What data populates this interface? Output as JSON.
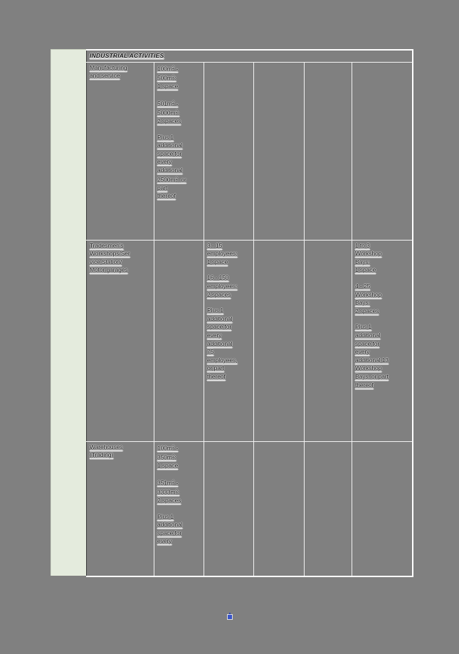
{
  "document": {
    "section_header": "INDUSTRIAL ACTIVITIES",
    "page_background": "#808080",
    "margin_strip_color": "#e4ebdd",
    "table_border_color": "#f2f2f2",
    "text_color": "#1b1b1b"
  },
  "table": {
    "columns": 6,
    "rows": [
      {
        "name": "manufacturing-and-service",
        "cells": {
          "activity": "Manufacturing\nand service",
          "floor_area": {
            "band1": "100m² -\n500m²:\n1 space",
            "band2": "501m² -\n5000m²:\n2 spaces",
            "band3": "Plus 1\nadditional\nspace for\nevery\nadditional\n2500m², or\npart\nthereof"
          },
          "employees": "",
          "col4": "",
          "col5": "",
          "workshop_bays": ""
        }
      },
      {
        "name": "tradesmens-workshops-service-station-motor-garages",
        "cells": {
          "activity": "Tradesmen's\nWorkshops/Ser\nvice Station/\nMotor garages",
          "floor_area": {
            "band1": "",
            "band2": "",
            "band3": ""
          },
          "employees": {
            "band1": "3 - 15\nemployees:\n1 space",
            "band2": "16 - 150\nemployees:\n2 spaces",
            "band3": "Plus 1\nadditional\nspace for\nevery\nadditional\n75\nemployees,\nor part\nthereof"
          },
          "col4": "",
          "col5": "",
          "workshop_bays": {
            "band1": "1 to 3\nWorkshop\nBays:\n1 space",
            "band2": "4 - 25\nWorkshop\nBays:\n2 spaces",
            "band3": "Plus 1\nadditional\nspace for\nevery\nadditional 13\nWorkshop\nBays, or part\nthereof"
          }
        }
      },
      {
        "name": "warehouses-trading",
        "cells": {
          "activity": "Warehouses\n(Trading)",
          "floor_area": {
            "band1": "100m² -\n350m²:\n1 space",
            "band2": "351m² -\n3333m²:\n2 spaces",
            "band3": "Plus 1\nadditional\nspace for\nevery"
          },
          "employees": "",
          "col4": "",
          "col5": "",
          "workshop_bays": ""
        }
      }
    ]
  },
  "artifacts": {
    "caret_color": "#3a55c8"
  }
}
